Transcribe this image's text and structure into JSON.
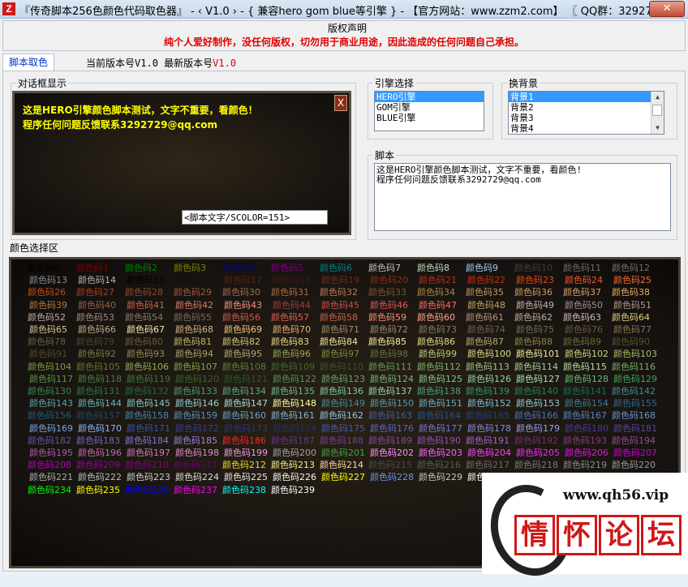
{
  "window": {
    "icon": "Z",
    "title": "『传奇脚本256色颜色代码取色器』 - ‹ V1.0 › - { 兼容hero gom blue等引擎 } - 【官方网站：www.zzm2.com】 〖 QQ群：3292729〗",
    "close_label": "✕"
  },
  "copyright": {
    "title": "版权声明",
    "text": "纯个人爱好制作，没任何版权，切勿用于商业用途，因此造成的任何问题自己承担。"
  },
  "tab": {
    "label": "脚本取色"
  },
  "version": {
    "current_label": "当前版本号",
    "current": "V1.0",
    "latest_label": "最新版本号",
    "latest": "V1.0"
  },
  "dialog": {
    "group_label": "对话框显示",
    "line1": "这是HERO引擎颜色脚本测试，文字不重要，看颜色！",
    "line2": "程序任何问题反馈联系3292729@qq.com",
    "close": "X",
    "input": "<脚本文字/SCOLOR=151>"
  },
  "engine": {
    "group_label": "引擎选择",
    "items": [
      "HERO引擎",
      "GOM引擎",
      "BLUE引擎"
    ],
    "selected": 0
  },
  "background": {
    "group_label": "换背景",
    "items": [
      "背景1",
      "背景2",
      "背景3",
      "背景4"
    ],
    "selected": 0
  },
  "script": {
    "group_label": "脚本",
    "line1": "这是HERO引擎颜色脚本测试，文字不重要，看颜色!",
    "line2": "程序任何问题反馈联系3292729@qq.com"
  },
  "palette": {
    "group_label": "颜色选择区",
    "prefix": "颜色码",
    "colors": [
      "#000000",
      "#800000",
      "#008000",
      "#808000",
      "#000080",
      "#800080",
      "#008080",
      "#c0c0c0",
      "#c0dcc0",
      "#a6caf0",
      "#404040",
      "#6c6c6c",
      "#737373",
      "#8c8c8c",
      "#b5b5b5",
      "#000000",
      "#18100c",
      "#5a2014",
      "#3c1c14",
      "#6b2c1c",
      "#8a2c18",
      "#ad3118",
      "#c63010",
      "#e84810",
      "#ef5a21",
      "#f76b31",
      "#c44a1a",
      "#a3401c",
      "#8c4c2c",
      "#9c5a39",
      "#a36b4a",
      "#ad6b3c",
      "#bd7b52",
      "#7a5430",
      "#b28446",
      "#c49a5c",
      "#ce9a5a",
      "#d7a26b",
      "#e6aa5a",
      "#b57b3c",
      "#94634a",
      "#ce634a",
      "#de7b63",
      "#f79484",
      "#a5393d",
      "#d64a4a",
      "#e95454",
      "#ff6b6b",
      "#c9a065",
      "#c6b5ad",
      "#a5948c",
      "#b59c8c",
      "#bdada5",
      "#a38c7b",
      "#8c7b6b",
      "#7b6b5a",
      "#d65a4a",
      "#e6604e",
      "#c86048",
      "#ff8c6b",
      "#ffa58c",
      "#bd9484",
      "#c6ad9c",
      "#d6bdb5",
      "#e1cc80",
      "#d6c694",
      "#bdad84",
      "#ffe7b5",
      "#d6b58c",
      "#f7c684",
      "#e7b573",
      "#a38c63",
      "#9c8c6b",
      "#8c7b5a",
      "#736352",
      "#736b5a",
      "#6b5a42",
      "#8c7352",
      "#6b6342",
      "#52422c",
      "#6a5a3a",
      "#c6b56b",
      "#d6c67b",
      "#e7d68c",
      "#f7e7a5",
      "#ffef9c",
      "#e7de84",
      "#b5ad6b",
      "#8c844a",
      "#736b39",
      "#5a5229",
      "#524a29",
      "#7b7b4a",
      "#948c5a",
      "#a5a56b",
      "#adad73",
      "#9ca55a",
      "#7b8c42",
      "#637339",
      "#bdce7b",
      "#d6de8c",
      "#e7ef9c",
      "#c6d684",
      "#a5bd63",
      "#849c42",
      "#637b29",
      "#94ad5a",
      "#7ba54a",
      "#5a8439",
      "#426b29",
      "#39522c",
      "#6b9c4a",
      "#84b56b",
      "#9cc684",
      "#a5ce94",
      "#b5dea5",
      "#7bad63",
      "#5a944a",
      "#4a7b42",
      "#397b39",
      "#31632c",
      "#295a29",
      "#52945a",
      "#63a56b",
      "#73b57b",
      "#84c68c",
      "#94d69c",
      "#a5e7ad",
      "#63bd73",
      "#42a55a",
      "#318c4a",
      "#297b42",
      "#216b39",
      "#4a9c73",
      "#5aad84",
      "#6bbd94",
      "#7bcea5",
      "#94d6b5",
      "#42a584",
      "#319473",
      "#21845a",
      "#107352",
      "#3c9090",
      "#5aa5a5",
      "#6bb5b5",
      "#84c6c6",
      "#94cece",
      "#a5dede",
      "#ffffad",
      "#4a8c9c",
      "#5a9cad",
      "#6badbd",
      "#84bdce",
      "#94c6d6",
      "#3c7c94",
      "#316b8c",
      "#295a7b",
      "#214a6b",
      "#4a84ad",
      "#5a94bd",
      "#6ba5ce",
      "#84b5d6",
      "#94c6e7",
      "#39639c",
      "#29528c",
      "#21427b",
      "#4a73b5",
      "#5a84c6",
      "#6b94d6",
      "#7ba5e7",
      "#8cb5f7",
      "#3c52a5",
      "#31428c",
      "#29397b",
      "#21316b",
      "#4a5aad",
      "#5a6bbd",
      "#737bce",
      "#848cde",
      "#9c9cef",
      "#4a3994",
      "#5a429c",
      "#6b52ad",
      "#7b63bd",
      "#8c73ce",
      "#9c84de",
      "#ff2424",
      "#633984",
      "#734294",
      "#844aa5",
      "#9452b5",
      "#a563c6",
      "#7b2c6b",
      "#8c397b",
      "#9c4a8c",
      "#ad5a9c",
      "#bd6bad",
      "#ce7bbd",
      "#de8cce",
      "#ef9cde",
      "#a5a5a5",
      "#3ca53c",
      "#ff8cff",
      "#ff63ff",
      "#ff42ff",
      "#f728f7",
      "#e610e6",
      "#ce00ce",
      "#b500b5",
      "#9c009c",
      "#840084",
      "#6b006b",
      "#f5d62d",
      "#f0f08b",
      "#ffd7a5",
      "#4a4a4a",
      "#5a5a5a",
      "#6b6b6b",
      "#7b7b7b",
      "#8c8c8c",
      "#9c9c9c",
      "#adadad",
      "#bdbdbd",
      "#cecece",
      "#dedede",
      "#e7e7e7",
      "#f7f7f7",
      "#ffff00",
      "#6b94e7",
      "#c6c6c6",
      "#fffbf0",
      "#a0a0a4",
      "#808080",
      "#ff3030",
      "#00ff00",
      "#ffff00",
      "#0000ff",
      "#ff00ff",
      "#00ffff",
      "#ffffff"
    ]
  },
  "watermark": {
    "url": "www.qh56.vip",
    "chars": [
      "情",
      "怀",
      "论",
      "坛"
    ]
  }
}
